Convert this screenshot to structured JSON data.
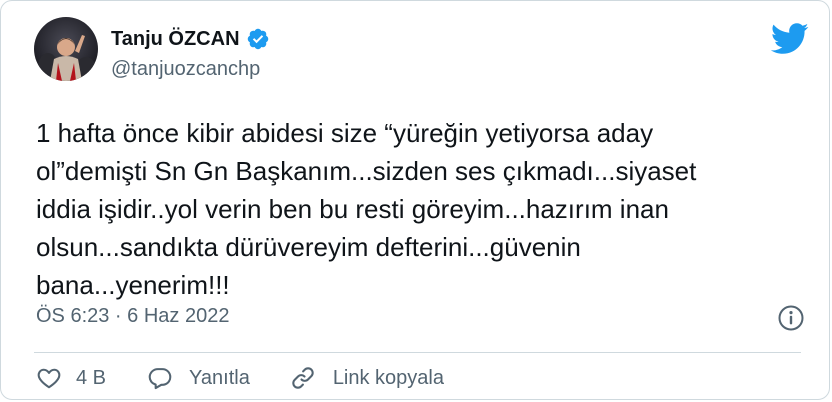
{
  "author": {
    "display_name": "Tanju ÖZCAN",
    "handle": "@tanjuozcanchp",
    "verified": true,
    "avatar_icon": "profile-photo"
  },
  "brand": {
    "icon": "twitter-bird-icon",
    "color": "#1d9bf0"
  },
  "tweet": {
    "text": "1 hafta önce kibir abidesi size “yüreğin yetiyorsa aday\nol”demişti Sn Gn Başkanım...sizden ses çıkmadı...siyaset\niddia işidir..yol verin ben bu resti göreyim...hazırım inan\nolsun...sandıkta dürüvereyim defterini...güvenin\nbana...yenerim!!!",
    "timestamp": "ÖS 6:23 · 6 Haz 2022"
  },
  "actions": {
    "like_count": "4 B",
    "reply_label": "Yanıtla",
    "copy_link_label": "Link kopyala"
  },
  "colors": {
    "text_primary": "#0f1419",
    "text_secondary": "#536471",
    "border": "#cfd9de",
    "verified_badge": "#1d9bf0"
  }
}
